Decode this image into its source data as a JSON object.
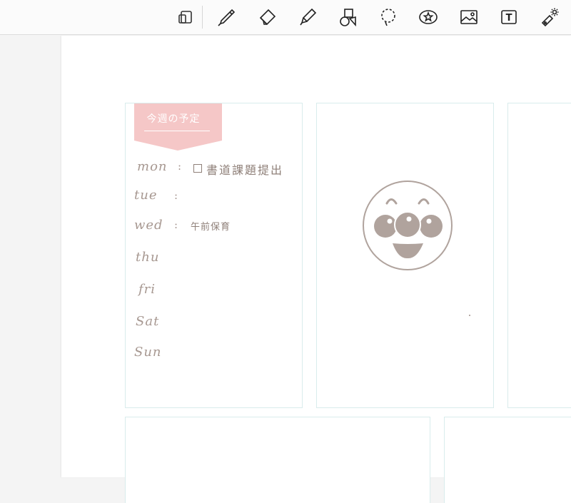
{
  "toolbar": {
    "tools": [
      {
        "name": "lasso-layout-tool",
        "icon": "page-layout-icon"
      },
      {
        "name": "pen-tool",
        "icon": "pen-icon"
      },
      {
        "name": "eraser-tool",
        "icon": "eraser-icon"
      },
      {
        "name": "highlighter-tool",
        "icon": "highlighter-icon"
      },
      {
        "name": "shapes-tool",
        "icon": "shapes-icon"
      },
      {
        "name": "lasso-tool",
        "icon": "lasso-icon"
      },
      {
        "name": "sticker-tool",
        "icon": "sticker-icon"
      },
      {
        "name": "image-tool",
        "icon": "image-icon"
      },
      {
        "name": "text-tool",
        "icon": "text-icon"
      },
      {
        "name": "laser-pointer-tool",
        "icon": "laser-pointer-icon"
      }
    ],
    "text_tool_glyph": "T"
  },
  "planner": {
    "ribbon_title": "今週の予定",
    "days": [
      {
        "label": "mon",
        "task": "書道課題提出",
        "has_checkbox": true
      },
      {
        "label": "tue",
        "task": "",
        "has_checkbox": false
      },
      {
        "label": "wed",
        "task": "午前保育",
        "has_checkbox": false
      },
      {
        "label": "thu",
        "task": "",
        "has_checkbox": false
      },
      {
        "label": "fri",
        "task": "",
        "has_checkbox": false
      },
      {
        "label": "Sat",
        "task": "",
        "has_checkbox": false
      },
      {
        "label": "Sun",
        "task": "",
        "has_checkbox": false
      }
    ],
    "colon": ":"
  },
  "colors": {
    "accent_ribbon": "#f5c7c7",
    "ink": "#a79891",
    "sticker": "#b0a39d",
    "card_border": "#d9ecec"
  }
}
